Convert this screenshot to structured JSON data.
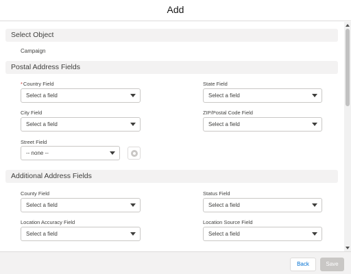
{
  "modal": {
    "title": "Add"
  },
  "select_object": {
    "header": "Select Object",
    "value": "Campaign"
  },
  "postal": {
    "header": "Postal Address Fields",
    "country_label": "Country Field",
    "country_required_mark": "*",
    "country_value": "Select a field",
    "state_label": "State Field",
    "state_value": "Select a field",
    "city_label": "City Field",
    "city_value": "Select a field",
    "zip_label": "ZIP/Postal Code Field",
    "zip_value": "Select a field",
    "street_label": "Street Field",
    "street_value": "-- none --"
  },
  "additional": {
    "header": "Additional Address Fields",
    "county_label": "County Field",
    "county_value": "Select a field",
    "status_label": "Status Field",
    "status_value": "Select a field",
    "accuracy_label": "Location Accuracy Field",
    "accuracy_value": "Select a field",
    "source_label": "Location Source Field",
    "source_value": "Select a field"
  },
  "footer": {
    "back_label": "Back",
    "save_label": "Save"
  },
  "colors": {
    "link_blue": "#0070d2",
    "required_red": "#c23934",
    "section_bg": "#f3f2f2",
    "disabled_button": "#c9c7c5"
  },
  "icons": {
    "dropdown": "chevron-down-icon",
    "street_settings": "gear-icon",
    "scroll_up": "scroll-up-arrow-icon",
    "scroll_down": "scroll-down-arrow-icon"
  }
}
